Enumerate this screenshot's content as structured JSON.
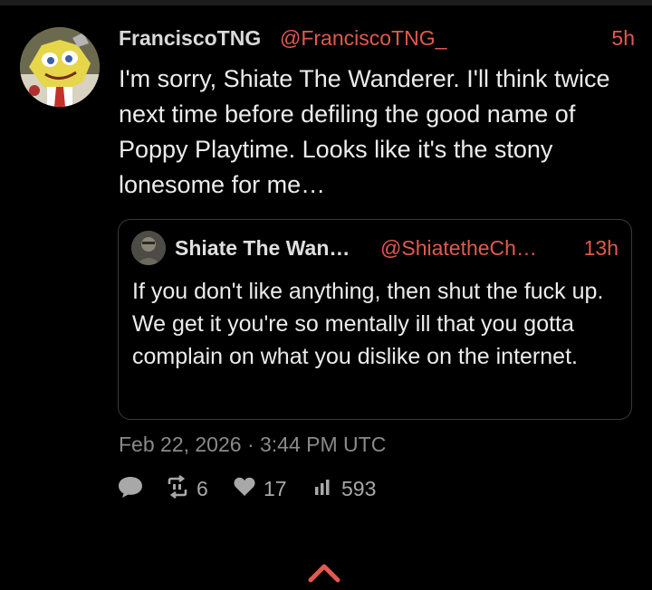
{
  "post": {
    "author": {
      "display_name": "FranciscoTNG",
      "handle": "@FranciscoTNG_",
      "avatar": "spongebob-avatar"
    },
    "time_ago": "5h",
    "text": "I'm sorry, Shiate The Wanderer. I'll think twice next time before defiling the good name of Poppy Playtime. Looks like it's the stony lonesome for me…",
    "timestamp": "Feb 22, 2026 · 3:44 PM UTC",
    "stats": {
      "retweets": "6",
      "likes": "17",
      "views": "593"
    }
  },
  "quoted_post": {
    "author": {
      "display_name": "Shiate The Wan…",
      "handle": "@ShiatetheCh…",
      "avatar": "user-avatar"
    },
    "time_ago": "13h",
    "text": "If you don't like anything, then shut the fuck up. We get it you're so mentally ill that you gotta complain on what you dislike on the internet."
  },
  "icons": {
    "reply": "speech-bubble-icon",
    "retweet": "retweet-icon",
    "like": "heart-icon",
    "views": "bar-chart-icon",
    "scroll_top": "chevron-up-icon"
  },
  "colors": {
    "background": "#000000",
    "accent": "#e05a4e",
    "muted": "#8a8a8a",
    "text": "#ececec"
  }
}
